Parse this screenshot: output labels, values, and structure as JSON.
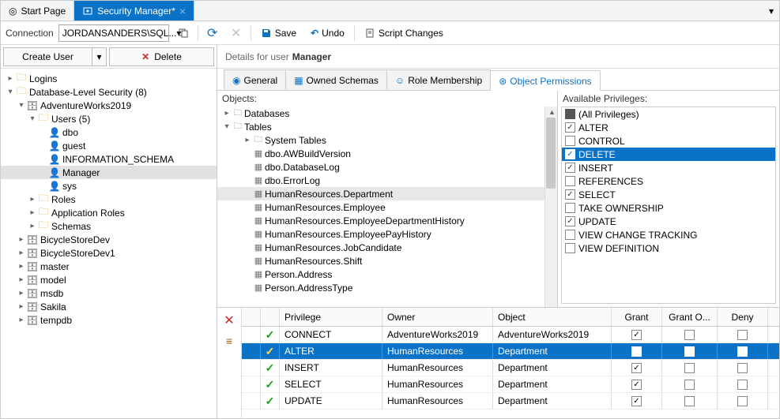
{
  "tabs": {
    "start": "Start Page",
    "security": "Security Manager*"
  },
  "toolbar": {
    "connection_label": "Connection",
    "connection_value": "JORDANSANDERS\\SQL...",
    "save": "Save",
    "undo": "Undo",
    "script": "Script Changes"
  },
  "left_actions": {
    "create": "Create User",
    "delete": "Delete"
  },
  "tree": {
    "logins": "Logins",
    "dbsec": "Database-Level Security  (8)",
    "aw": "AdventureWorks2019",
    "users": "Users (5)",
    "u_dbo": "dbo",
    "u_guest": "guest",
    "u_info": "INFORMATION_SCHEMA",
    "u_manager": "Manager",
    "u_sys": "sys",
    "roles": "Roles",
    "approles": "Application Roles",
    "schemas": "Schemas",
    "db1": "BicycleStoreDev",
    "db2": "BicycleStoreDev1",
    "db3": "master",
    "db4": "model",
    "db5": "msdb",
    "db6": "Sakila",
    "db7": "tempdb"
  },
  "details": {
    "prefix": "Details for user",
    "name": "Manager"
  },
  "subtabs": {
    "general": "General",
    "owned": "Owned Schemas",
    "role": "Role Membership",
    "perms": "Object Permissions"
  },
  "objects": {
    "label": "Objects:",
    "databases": "Databases",
    "tables": "Tables",
    "items": [
      "System Tables",
      "dbo.AWBuildVersion",
      "dbo.DatabaseLog",
      "dbo.ErrorLog",
      "HumanResources.Department",
      "HumanResources.Employee",
      "HumanResources.EmployeeDepartmentHistory",
      "HumanResources.EmployeePayHistory",
      "HumanResources.JobCandidate",
      "HumanResources.Shift",
      "Person.Address",
      "Person.AddressType"
    ]
  },
  "privs": {
    "label": "Available Privileges:",
    "items": [
      {
        "name": "(All Privileges)",
        "checked": false,
        "hdr": true
      },
      {
        "name": "ALTER",
        "checked": true
      },
      {
        "name": "CONTROL",
        "checked": false
      },
      {
        "name": "DELETE",
        "checked": true,
        "sel": true
      },
      {
        "name": "INSERT",
        "checked": true
      },
      {
        "name": "REFERENCES",
        "checked": false
      },
      {
        "name": "SELECT",
        "checked": true
      },
      {
        "name": "TAKE OWNERSHIP",
        "checked": false
      },
      {
        "name": "UPDATE",
        "checked": true
      },
      {
        "name": "VIEW CHANGE TRACKING",
        "checked": false
      },
      {
        "name": "VIEW DEFINITION",
        "checked": false
      }
    ]
  },
  "grid": {
    "headers": {
      "priv": "Privilege",
      "owner": "Owner",
      "object": "Object",
      "grant": "Grant",
      "granto": "Grant O...",
      "deny": "Deny"
    },
    "rows": [
      {
        "priv": "CONNECT",
        "owner": "AdventureWorks2019",
        "object": "AdventureWorks2019",
        "grant": true,
        "sel": false
      },
      {
        "priv": "ALTER",
        "owner": "HumanResources",
        "object": "Department",
        "grant": true,
        "sel": true
      },
      {
        "priv": "INSERT",
        "owner": "HumanResources",
        "object": "Department",
        "grant": true,
        "sel": false
      },
      {
        "priv": "SELECT",
        "owner": "HumanResources",
        "object": "Department",
        "grant": true,
        "sel": false
      },
      {
        "priv": "UPDATE",
        "owner": "HumanResources",
        "object": "Department",
        "grant": true,
        "sel": false
      }
    ]
  }
}
